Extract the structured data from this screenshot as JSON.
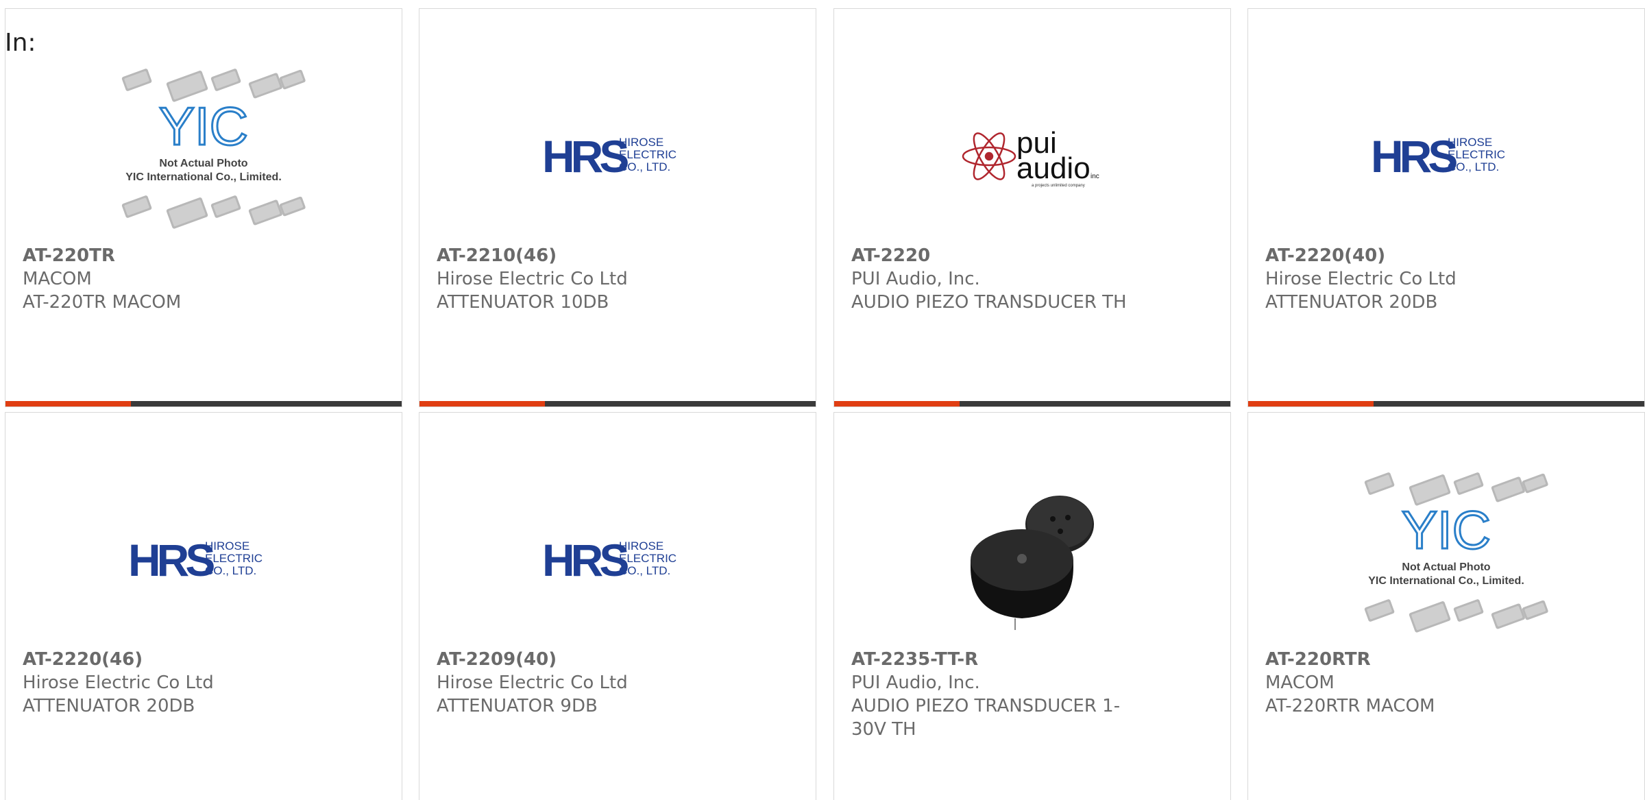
{
  "filter": {
    "label": "In:"
  },
  "colors": {
    "accent": "#e03e12",
    "bar_dark": "#3a3a3a",
    "text": "#6a6a6a",
    "hrs_blue": "#1f3f94",
    "pui_red": "#b0262e"
  },
  "products": [
    {
      "part_number": "AT-220TR",
      "manufacturer": "MACOM",
      "description": "AT-220TR MACOM",
      "image": "yic-placeholder"
    },
    {
      "part_number": "AT-2210(46)",
      "manufacturer": "Hirose Electric Co Ltd",
      "description": "ATTENUATOR 10DB",
      "image": "hrs-logo"
    },
    {
      "part_number": "AT-2220",
      "manufacturer": "PUI Audio, Inc.",
      "description": "AUDIO PIEZO TRANSDUCER TH",
      "image": "pui-audio-logo"
    },
    {
      "part_number": "AT-2220(40)",
      "manufacturer": "Hirose Electric Co Ltd",
      "description": "ATTENUATOR 20DB",
      "image": "hrs-logo"
    },
    {
      "part_number": "AT-2220(46)",
      "manufacturer": "Hirose Electric Co Ltd",
      "description": "ATTENUATOR 20DB",
      "image": "hrs-logo"
    },
    {
      "part_number": "AT-2209(40)",
      "manufacturer": "Hirose Electric Co Ltd",
      "description": "ATTENUATOR 9DB",
      "image": "hrs-logo"
    },
    {
      "part_number": "AT-2235-TT-R",
      "manufacturer": "PUI Audio, Inc.",
      "description": "AUDIO PIEZO TRANSDUCER 1-30V TH",
      "image": "piezo-photo"
    },
    {
      "part_number": "AT-220RTR",
      "manufacturer": "MACOM",
      "description": "AT-220RTR MACOM",
      "image": "yic-placeholder"
    }
  ],
  "logos": {
    "hrs": {
      "mark": "HRS",
      "line1": "HIROSE",
      "line2": "ELECTRIC",
      "line3": "CO., LTD."
    },
    "pui": {
      "word1": "pui",
      "word2": "audio",
      "inc": "inc",
      "tagline": "a projects unlimited company"
    },
    "yic": {
      "mark": "YIC",
      "line1": "Not Actual Photo",
      "line2": "YIC International Co., Limited."
    }
  }
}
